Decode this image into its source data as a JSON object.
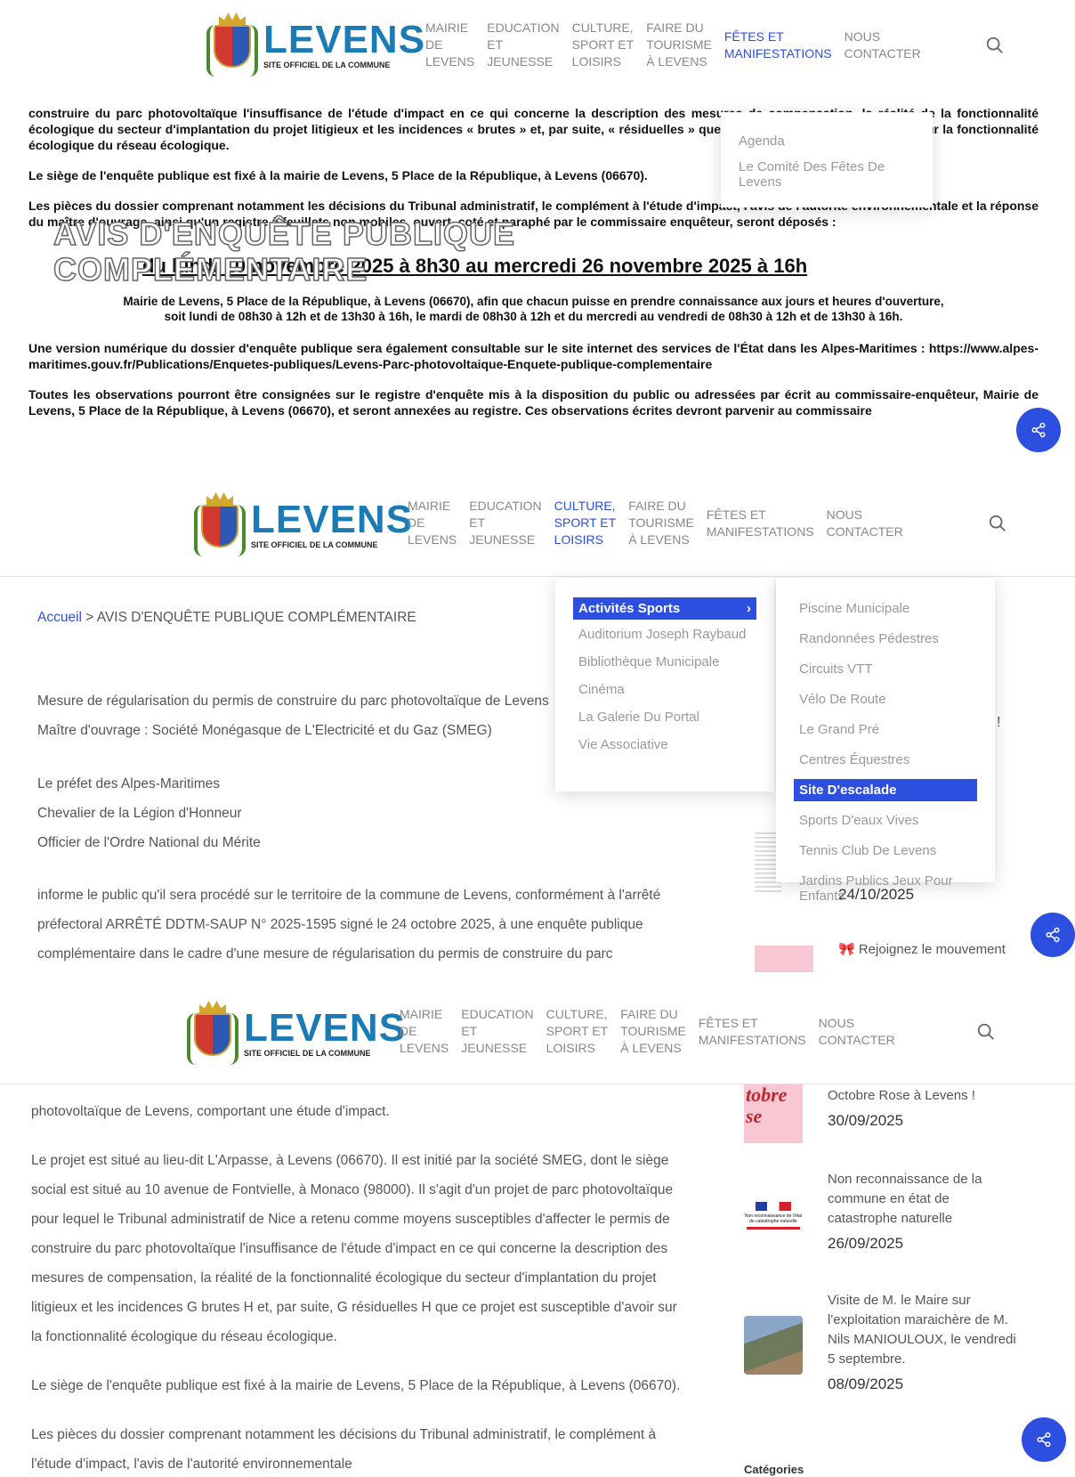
{
  "logo": {
    "name": "LEVENS",
    "sub": "SITE OFFICIEL DE LA COMMUNE"
  },
  "nav": [
    {
      "l1": "MAIRIE",
      "l2": "DE",
      "l3": "LEVENS"
    },
    {
      "l1": "EDUCATION",
      "l2": "ET",
      "l3": "JEUNESSE"
    },
    {
      "l1": "CULTURE,",
      "l2": "SPORT ET",
      "l3": "LOISIRS"
    },
    {
      "l1": "FAIRE DU",
      "l2": "TOURISME",
      "l3": "À LEVENS"
    },
    {
      "l1": "FÊTES ET",
      "l2": "MANIFESTATIONS",
      "l3": ""
    },
    {
      "l1": "NOUS",
      "l2": "CONTACTER",
      "l3": ""
    }
  ],
  "panel1": {
    "p1": "construire du parc photovoltaïque l'insuffisance de l'étude d'impact en ce qui concerne la description des mesures de compensation, la réalité de la fonctionnalité écologique du secteur d'implantation du projet litigieux et les incidences « brutes » et, par suite, « résiduelles » que ce projet est susceptible d'avoir sur la fonctionnalité écologique du réseau écologique.",
    "p2": "Le siège de l'enquête publique est fixé à la mairie de Levens, 5 Place de la République, à Levens (06670).",
    "p3": "Les pièces du dossier comprenant notamment les décisions du Tribunal administratif, le complément à l'étude d'impact, l'avis de l'autorité environnementale et la réponse du maître d'ouvrage, ainsi qu'un registre à feuillets non mobiles, ouvert, coté et paraphé par le commissaire enquêteur, seront déposés :",
    "overlay_title_1": "AVIS D'ENQUÊTE PUBLIQUE",
    "overlay_title_2": "COMPLÉMENTAIRE",
    "date_line": "du lundi 10 novembre 2025 à 8h30 au mercredi 26 novembre 2025 à 16h",
    "center1": "Mairie de Levens, 5 Place de la République, à Levens (06670), afin que chacun puisse en prendre connaissance aux jours et heures d'ouverture,",
    "center2": "soit lundi de 08h30 à 12h et de 13h30 à 16h, le mardi de 08h30 à 12h et du mercredi au vendredi de 08h30 à 12h et de 13h30 à 16h.",
    "p4": "Une version numérique du dossier d'enquête publique sera également consultable sur le site internet des services de l'État dans les Alpes-Maritimes : https://www.alpes-maritimes.gouv.fr/Publications/Enquetes-publiques/Levens-Parc-photovoltaique-Enquete-publique-complementaire",
    "p5": "Toutes les observations pourront être consignées sur le registre d'enquête mis à la disposition du public ou adressées par écrit au commissaire-enquêteur, Mairie de Levens, 5 Place de la République, à Levens (06670), et seront annexées au registre. Ces observations écrites devront parvenir au commissaire",
    "dropdown": [
      "Agenda",
      "Le Comité Des Fêtes De Levens"
    ]
  },
  "panel2": {
    "breadcrumb_home": "Accueil",
    "breadcrumb_sep": " > ",
    "breadcrumb_current": "AVIS D'ENQUÊTE PUBLIQUE COMPLÉMENTAIRE",
    "lines": [
      "Mesure de régularisation du permis de construire du parc photovoltaïque de Levens",
      "Maître d'ouvrage : Société Monégasque de L'Electricité et du Gaz (SMEG)"
    ],
    "prefet": [
      "Le préfet des Alpes-Maritimes",
      "Chevalier de la Légion d'Honneur",
      "Officier de l'Ordre National du Mérite"
    ],
    "inform": [
      "informe le public qu'il sera procédé sur le territoire de la commune de Levens, conformément à l'arrêté",
      "préfectoral ARRÊTÉ DDTM-SAUP N° 2025-1595 signé le 24 octobre 2025, à une enquête publique",
      "complémentaire dans le cadre d'une mesure de régularisation du permis de construire du parc"
    ],
    "menu1": [
      "Activités Sports",
      "Auditorium Joseph Raybaud",
      "Bibliothèque Municipale",
      "Cinéma",
      "La Galerie Du Portal",
      "Vie Associative"
    ],
    "menu2": [
      "Piscine Municipale",
      "Randonnées Pédestres",
      "Circuits VTT",
      "Vélo De Route",
      "Le Grand Pré",
      "Centres Équestres",
      "Site D'escalade",
      "Sports D'eaux Vives",
      "Tennis Club De Levens",
      "Jardins Publics Jeux Pour Enfants"
    ],
    "side_date1": "24/10/2025",
    "side_title2": "🎀 Rejoignez le mouvement",
    "exclaim": "!"
  },
  "panel3": {
    "paras": [
      "photovoltaïque de Levens, comportant une étude d'impact.",
      "Le projet est situé au lieu-dit L'Arpasse, à Levens (06670). Il est initié par la société SMEG, dont le siège",
      "social est situé au 10 avenue de Fontvielle, à Monaco (98000). Il s'agit d'un projet de parc photovoltaïque",
      "pour lequel le Tribunal administratif de Nice a retenu comme moyens susceptibles d'affecter le permis de",
      "construire du parc photovoltaïque l'insuffisance de l'étude d'impact en ce qui concerne la description des",
      "mesures de compensation, la réalité de la fonctionnalité écologique du secteur d'implantation du projet",
      "litigieux et les incidences G brutes H et, par suite, G résiduelles H que ce projet est susceptible d'avoir sur",
      "la fonctionnalité écologique du réseau écologique.",
      "Le siège de l'enquête publique est fixé à la mairie de Levens, 5 Place de la République, à Levens (06670).",
      "Les pièces du dossier comprenant notamment les décisions du Tribunal administratif, le complément à",
      "l'étude d'impact, l'avis de l'autorité environnementale"
    ],
    "side": [
      {
        "title": "Octobre Rose à Levens !",
        "date": "30/09/2025"
      },
      {
        "title": "Non reconnaissance de la commune en état de catastrophe naturelle",
        "date": "26/09/2025"
      },
      {
        "title": "Visite de M. le Maire sur l'exploitation maraichère de M. Nils MANIOULOUX, le vendredi 5 septembre.",
        "date": "08/09/2025"
      }
    ],
    "categories": "Catégories",
    "thumb_text1": "tobre",
    "thumb_text2": "se",
    "thumb_text3": "Non reconnaissance de l'état de catastrophe naturelle"
  },
  "colors": {
    "accent": "#2d4fe0",
    "logo": "#1b7bb5"
  }
}
